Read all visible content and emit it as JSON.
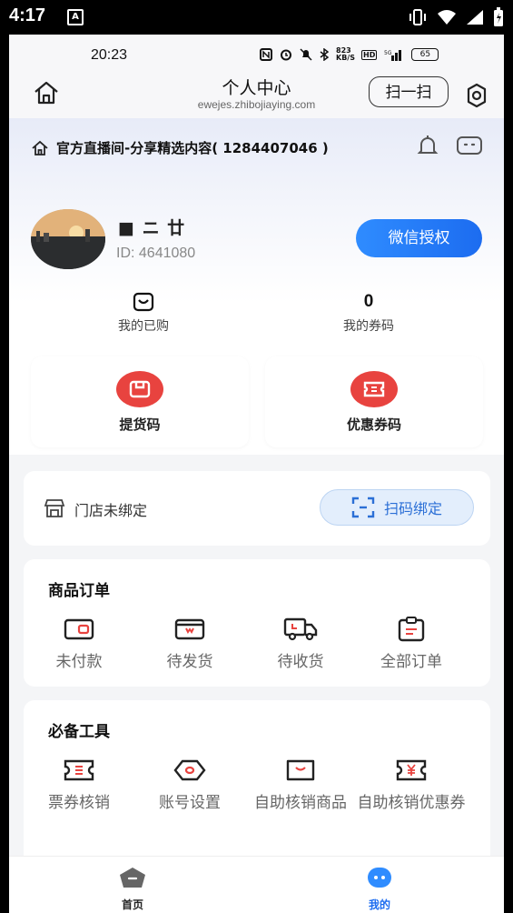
{
  "system_status": {
    "time": "4:17",
    "notification_icon": "A"
  },
  "inner_status": {
    "time": "20:23",
    "speed": "823 KB/S",
    "battery": "65"
  },
  "header": {
    "title": "个人中心",
    "subtitle": "ewejes.zhibojiaying.com",
    "scan_label": "扫一扫"
  },
  "notice": {
    "text": "官方直播间-分享精选内容( 1284407046 )"
  },
  "profile": {
    "name": "■ ニ 廿",
    "id_text": "ID: 4641080",
    "auth_button": "微信授权"
  },
  "stats": [
    {
      "value": "",
      "label": "我的已购"
    },
    {
      "value": "0",
      "label": "我的券码"
    }
  ],
  "quick_actions": [
    {
      "label": "提货码"
    },
    {
      "label": "优惠券码"
    }
  ],
  "store": {
    "text": "门店未绑定",
    "button": "扫码绑定"
  },
  "orders": {
    "title": "商品订单",
    "items": [
      {
        "label": "未付款",
        "icon": "wallet-icon"
      },
      {
        "label": "待发货",
        "icon": "package-icon"
      },
      {
        "label": "待收货",
        "icon": "truck-icon"
      },
      {
        "label": "全部订单",
        "icon": "clipboard-icon"
      }
    ]
  },
  "tools": {
    "title": "必备工具",
    "items": [
      {
        "label": "票券核销",
        "icon": "ticket-icon"
      },
      {
        "label": "账号设置",
        "icon": "account-settings-icon"
      },
      {
        "label": "自助核销商品",
        "icon": "bag-icon"
      },
      {
        "label": "自助核销优惠券",
        "icon": "coupon-yen-icon"
      }
    ]
  },
  "tabbar": {
    "items": [
      {
        "label": "首页",
        "active": false
      },
      {
        "label": "我的",
        "active": true
      }
    ]
  },
  "colors": {
    "accent": "#1c6cf0",
    "red": "#e8433f"
  }
}
